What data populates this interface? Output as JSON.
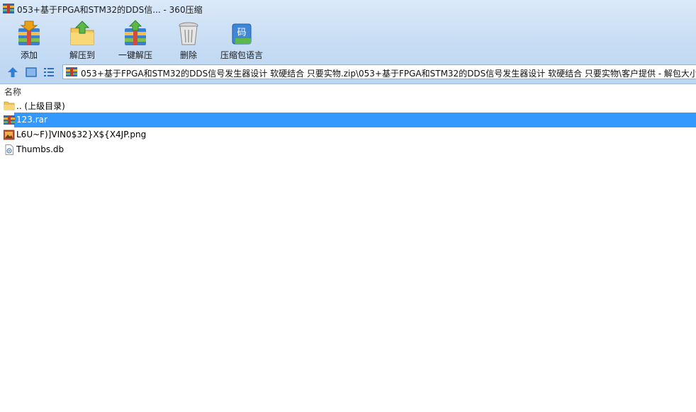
{
  "window": {
    "title": "053+基于FPGA和STM32的DDS信... - 360压缩"
  },
  "toolbar": {
    "add_label": "添加",
    "extract_to_label": "解压到",
    "one_click_extract_label": "一键解压",
    "delete_label": "删除",
    "archive_language_label": "压缩包语言",
    "language_icon_glyph": "码"
  },
  "address": {
    "path": "053+基于FPGA和STM32的DDS信号发生器设计 软硬结合  只要实物.zip\\053+基于FPGA和STM32的DDS信号发生器设计 软硬结合  只要实物\\客户提供 - 解包大小"
  },
  "list": {
    "column_name": "名称",
    "items": [
      {
        "label": ".. (上级目录)",
        "icon": "folder-icon"
      },
      {
        "label": "123.rar",
        "icon": "rar-archive-icon",
        "selected": true
      },
      {
        "label": "L6U~F)]VIN0$32}X${X4JP.png",
        "icon": "image-file-icon"
      },
      {
        "label": "Thumbs.db",
        "icon": "db-file-icon"
      }
    ]
  },
  "colors": {
    "selection": "#3399ff",
    "chrome": "#c6dcf4"
  }
}
